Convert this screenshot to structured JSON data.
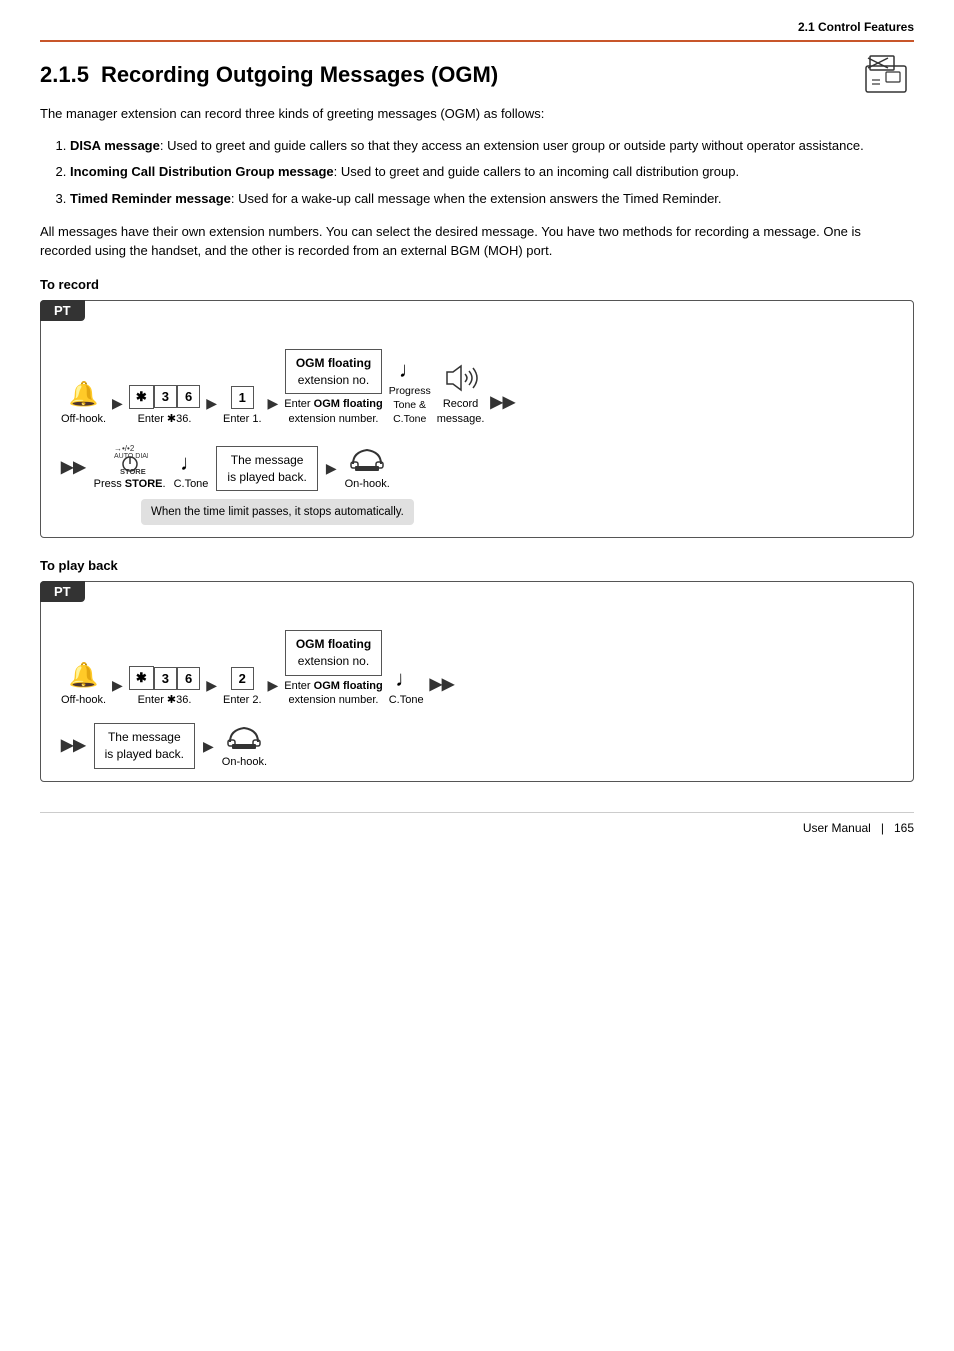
{
  "header": {
    "section": "2.1 Control Features"
  },
  "page": {
    "section_num": "2.1.5",
    "section_title": "Recording Outgoing Messages (OGM)",
    "intro": "The manager extension can record three kinds of greeting messages (OGM) as follows:",
    "bullets": [
      {
        "num": "1.",
        "bold": "DISA message",
        "text": ": Used to greet and guide callers so that they access an extension user group or outside party without operator assistance."
      },
      {
        "num": "2.",
        "bold": "Incoming Call Distribution Group message",
        "text": ": Used to greet and guide callers to an incoming call distribution group."
      },
      {
        "num": "3.",
        "bold": "Timed Reminder message",
        "text": ": Used for a wake-up call message when the extension answers the Timed Reminder."
      }
    ],
    "para": "All messages have their own extension numbers. You can select the desired message. You have two methods for recording a message. One is recorded using the handset, and the other is recorded from an external BGM (MOH) port.",
    "to_record": {
      "heading": "To record",
      "pt_label": "PT",
      "row1": {
        "off_hook_label": "Off-hook.",
        "enter_star36_label": "Enter ✱36.",
        "enter1_label": "Enter 1.",
        "ogm_box_line1": "OGM floating",
        "ogm_box_line2": "extension no.",
        "enter_ogm_label": "Enter OGM floating",
        "enter_ogm_label2": "extension number.",
        "progress_line1": "Progress",
        "progress_line2": "Tone &",
        "progress_line3": "C.Tone",
        "record_label": "Record",
        "record_label2": "message."
      },
      "row2": {
        "press_store_label": "Press STORE.",
        "ctone_label": "C.Tone",
        "message_played_line1": "The message",
        "message_played_line2": "is played back.",
        "on_hook_label": "On-hook.",
        "note_text": "When the time limit passes, it stops automatically."
      }
    },
    "to_play_back": {
      "heading": "To play back",
      "pt_label": "PT",
      "row1": {
        "off_hook_label": "Off-hook.",
        "enter_star36_label": "Enter ✱36.",
        "enter2_label": "Enter 2.",
        "ogm_box_line1": "OGM floating",
        "ogm_box_line2": "extension no.",
        "enter_ogm_label": "Enter OGM floating",
        "enter_ogm_label2": "extension number.",
        "ctone_label": "C.Tone"
      },
      "row2": {
        "message_played_line1": "The message",
        "message_played_line2": "is played back.",
        "on_hook_label": "On-hook."
      }
    }
  },
  "footer": {
    "text": "User Manual",
    "page": "165"
  }
}
